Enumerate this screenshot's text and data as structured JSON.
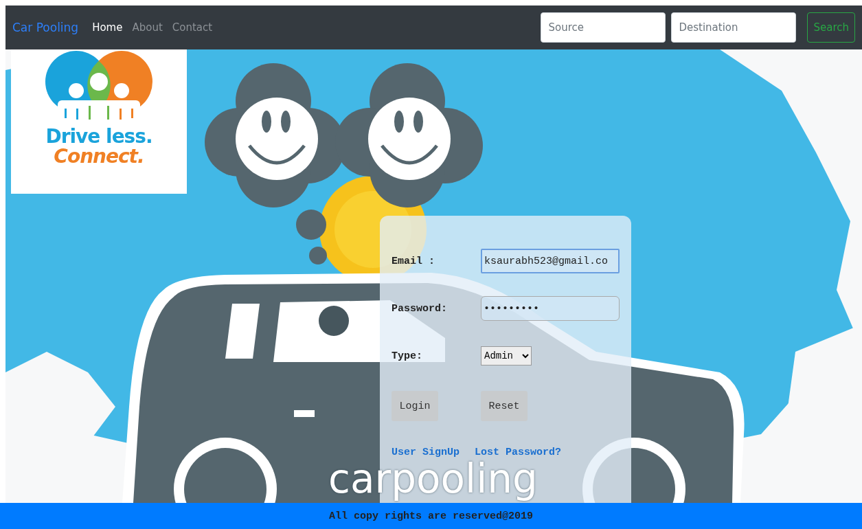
{
  "navbar": {
    "brand": "Car Pooling",
    "links": [
      {
        "label": "Home",
        "selected": true
      },
      {
        "label": "About",
        "selected": false
      },
      {
        "label": "Contact",
        "selected": false
      }
    ],
    "source": {
      "placeholder": "Source"
    },
    "destination": {
      "placeholder": "Destination"
    },
    "search_button": "Search"
  },
  "logo": {
    "line_1": "Drive less.",
    "line_2": "Connect."
  },
  "illustration": {
    "caption": "carpooling"
  },
  "login": {
    "fields": [
      {
        "kind": "text",
        "label": "Email :",
        "value": "ksaurabh523@gmail.co",
        "focused": true
      },
      {
        "kind": "text",
        "label": "Password:",
        "value": "•••••••••",
        "focused": false
      },
      {
        "kind": "select",
        "label": "Type:",
        "value": "Admin",
        "focused": false
      }
    ],
    "buttons": [
      "Login",
      "Reset"
    ],
    "links": [
      "User SignUp",
      "Lost Password?"
    ]
  },
  "footer": "All copy rights are reserved@2019"
}
